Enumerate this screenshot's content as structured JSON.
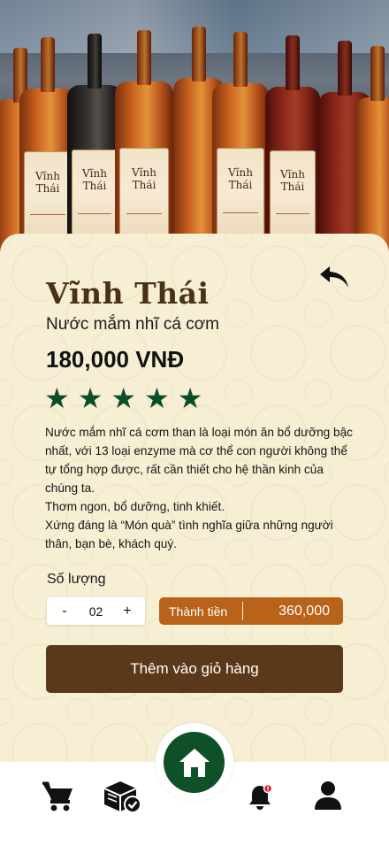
{
  "product": {
    "brand": "Vĩnh Thái",
    "name": "Nước mắm nhĩ cá cơm",
    "price": "180,000 VNĐ",
    "rating": 5,
    "description": [
      "Nước mắm nhĩ cá cơm than là loại món ăn bổ dưỡng bậc nhất, với 13 loại enzyme mà cơ thể con người không thể tự tổng hợp được, rất cần thiết cho hệ thần kinh của chúng ta.",
      "Thơm ngon, bổ dưỡng, tinh khiết.",
      "Xứng đáng là “Món quà” tình nghĩa giữa những người thân, bạn bè, khách quý."
    ]
  },
  "hero": {
    "label_text": "Vĩnh Thái"
  },
  "quantity": {
    "label": "Số lượng",
    "decrement": "-",
    "value": "02",
    "increment": "+"
  },
  "total": {
    "label": "Thành tiền",
    "value": "360,000"
  },
  "actions": {
    "add_to_cart": "Thêm vào giỏ hàng"
  },
  "nav": {
    "items": [
      "cart-icon",
      "orders-icon",
      "home-icon",
      "notification-icon",
      "profile-icon"
    ],
    "active": "home-icon"
  },
  "colors": {
    "brand_brown": "#5a391b",
    "total_orange": "#b8621a",
    "star_green": "#0b4d2b",
    "home_green": "#0e5128",
    "card_bg": "#f6efd3",
    "notification_dot": "#d81f1f"
  }
}
